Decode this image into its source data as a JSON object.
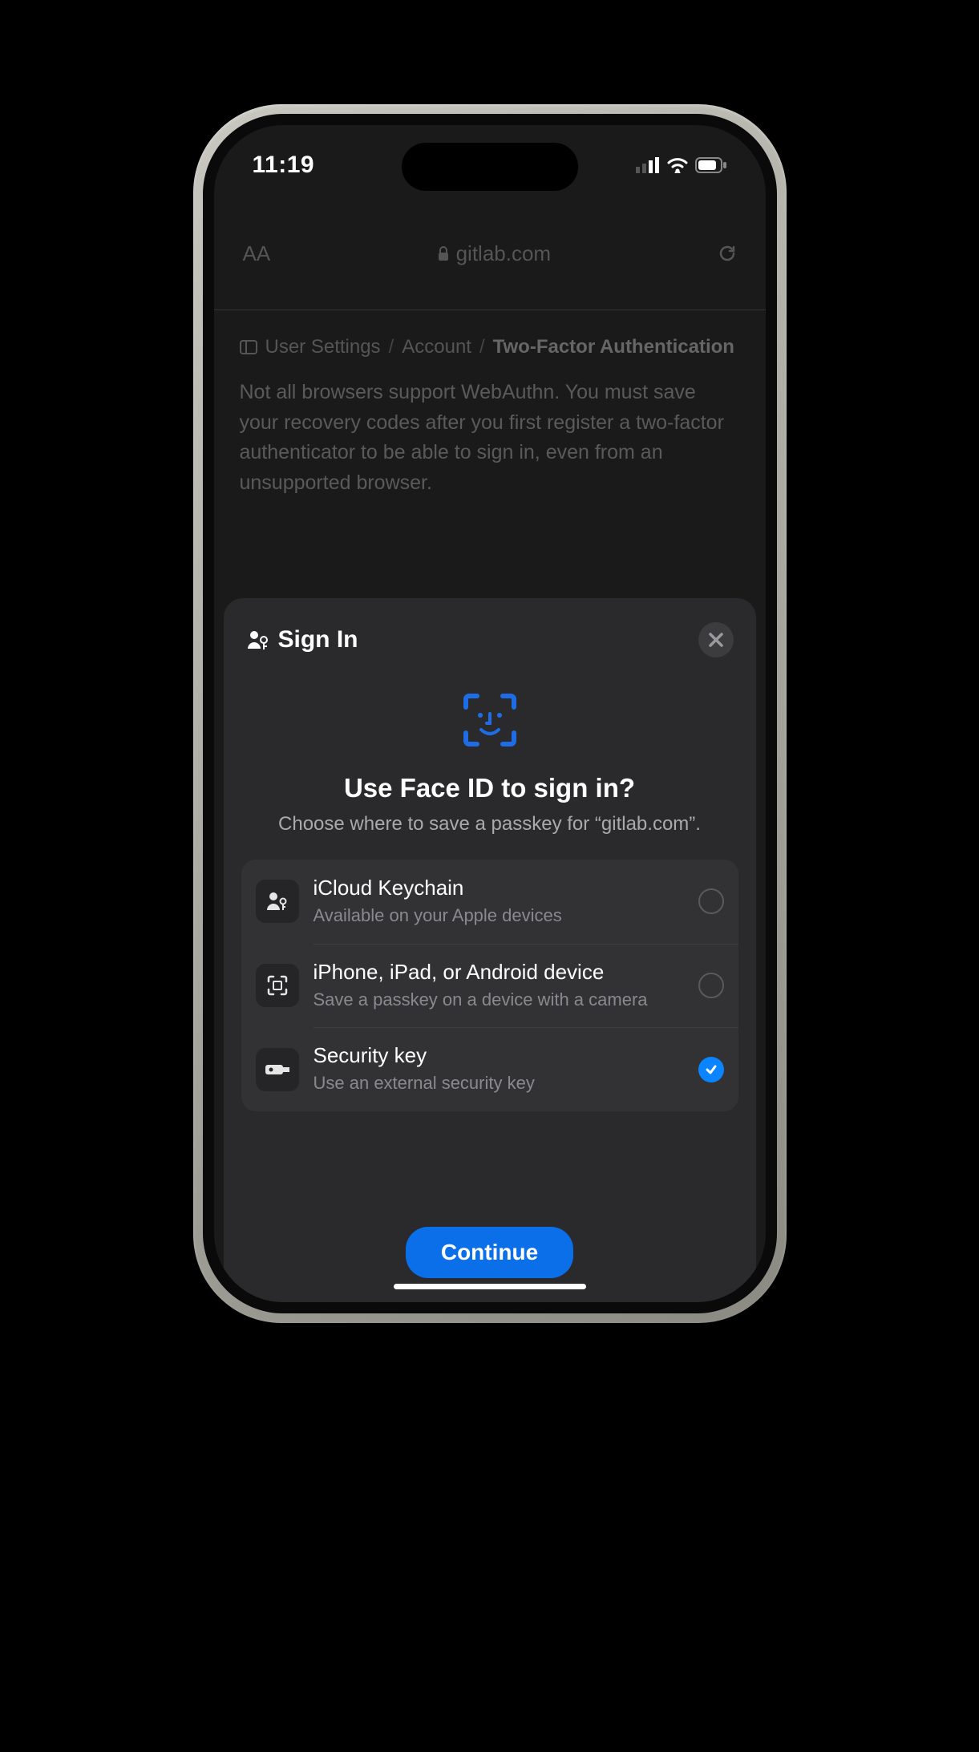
{
  "status": {
    "time": "11:19"
  },
  "urlbar": {
    "aa": "AA",
    "domain": "gitlab.com"
  },
  "breadcrumb": {
    "a": "User Settings",
    "b": "Account",
    "c": "Two-Factor Authentication"
  },
  "page_body": "Not all browsers support WebAuthn. You must save your recovery codes after you first register a two-factor authenticator to be able to sign in, even from an unsupported browser.",
  "sheet": {
    "header": "Sign In",
    "title": "Use Face ID to sign in?",
    "subtitle": "Choose where to save a passkey for “gitlab.com”.",
    "continue": "Continue"
  },
  "options": [
    {
      "title": "iCloud Keychain",
      "sub": "Available on your Apple devices",
      "selected": false
    },
    {
      "title": "iPhone, iPad, or Android device",
      "sub": "Save a passkey on a device with a camera",
      "selected": false
    },
    {
      "title": "Security key",
      "sub": "Use an external security key",
      "selected": true
    }
  ]
}
